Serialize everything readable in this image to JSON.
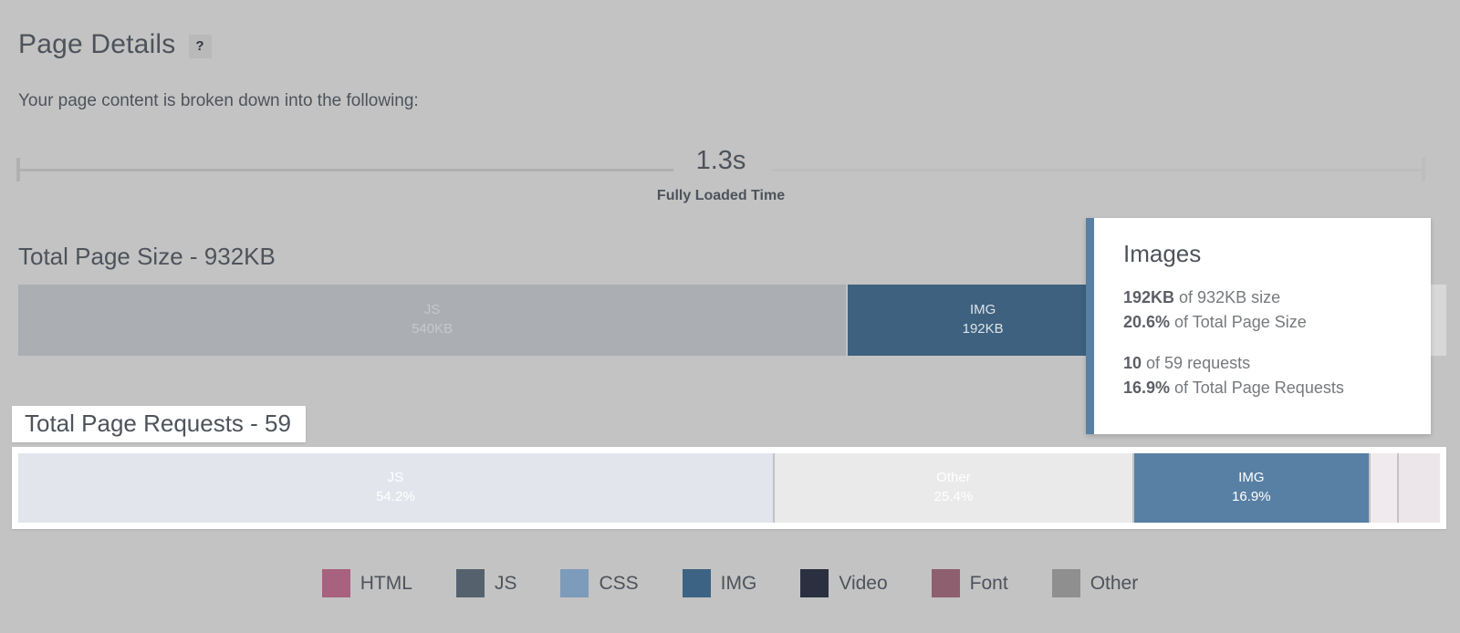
{
  "header": {
    "title": "Page Details",
    "help_badge": "?",
    "subtitle": "Your page content is broken down into the following:"
  },
  "timeline": {
    "value": "1.3s",
    "label": "Fully Loaded Time"
  },
  "page_size": {
    "heading": "Total Page Size - 932KB",
    "segments": [
      {
        "label": "JS",
        "value": "540KB",
        "width_pct": 56.6,
        "state": "dim"
      },
      {
        "label": "IMG",
        "value": "192KB",
        "width_pct": 20.6,
        "state": "highlight"
      }
    ]
  },
  "page_requests": {
    "heading": "Total Page Requests - 59",
    "segments": [
      {
        "label": "JS",
        "value": "54.2%",
        "width_pct": 54.2
      },
      {
        "label": "Other",
        "value": "25.4%",
        "width_pct": 25.4
      },
      {
        "label": "IMG",
        "value": "16.9%",
        "width_pct": 16.9
      },
      {
        "label": "",
        "value": "",
        "width_pct": 2.0
      },
      {
        "label": "",
        "value": "",
        "width_pct": 2.5
      }
    ]
  },
  "tooltip": {
    "title": "Images",
    "size_value": "192KB",
    "size_rest": " of 932KB size",
    "size_pct": "20.6%",
    "size_pct_rest": " of Total Page Size",
    "req_value": "10",
    "req_rest": " of 59 requests",
    "req_pct": "16.9%",
    "req_pct_rest": " of Total Page Requests"
  },
  "legend": {
    "items": [
      {
        "label": "HTML",
        "color": "#a8617f"
      },
      {
        "label": "JS",
        "color": "#55626e"
      },
      {
        "label": "CSS",
        "color": "#7d9bbb"
      },
      {
        "label": "IMG",
        "color": "#3d6384"
      },
      {
        "label": "Video",
        "color": "#2b3040"
      },
      {
        "label": "Font",
        "color": "#8e5f6e"
      },
      {
        "label": "Other",
        "color": "#8f8f8f"
      }
    ]
  },
  "colors": {
    "page_background": "#c3c3c3",
    "accent_blue": "#5880a4",
    "text": "#4e535b"
  },
  "chart_data": {
    "type": "bar",
    "title": "Page Details",
    "charts": [
      {
        "name": "Total Page Size",
        "total": "932KB",
        "categories": [
          "JS",
          "IMG"
        ],
        "values": [
          540,
          192
        ],
        "units": "KB",
        "labels": [
          "540KB",
          "192KB"
        ]
      },
      {
        "name": "Total Page Requests",
        "total": 59,
        "categories": [
          "JS",
          "Other",
          "IMG",
          "HTML",
          "Font"
        ],
        "values": [
          54.2,
          25.4,
          16.9,
          2.0,
          2.5
        ],
        "units": "%",
        "labels": [
          "54.2%",
          "25.4%",
          "16.9%",
          "",
          ""
        ]
      }
    ],
    "legend_position": "bottom",
    "legend": [
      "HTML",
      "JS",
      "CSS",
      "IMG",
      "Video",
      "Font",
      "Other"
    ]
  }
}
